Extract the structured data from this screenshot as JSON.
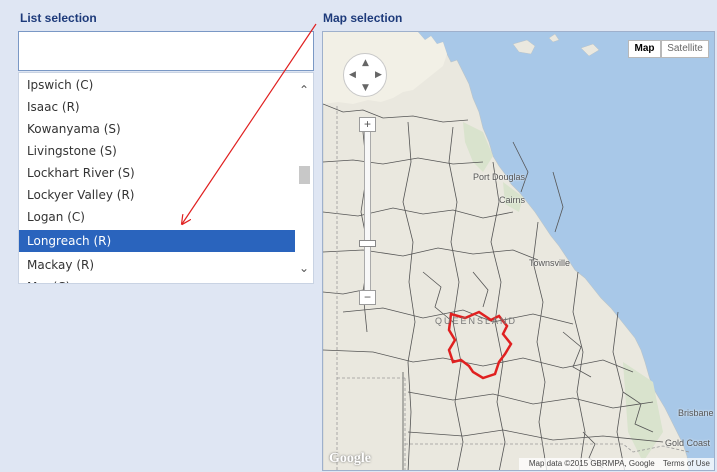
{
  "labels": {
    "list_selection": "List selection",
    "map_selection": "Map selection"
  },
  "search": {
    "value": "",
    "placeholder": ""
  },
  "list": {
    "items": [
      {
        "label": "Ipswich (C)"
      },
      {
        "label": "Isaac (R)"
      },
      {
        "label": "Kowanyama (S)"
      },
      {
        "label": "Livingstone (S)"
      },
      {
        "label": "Lockhart River (S)"
      },
      {
        "label": "Lockyer Valley (R)"
      },
      {
        "label": "Logan (C)"
      },
      {
        "label": "Longreach (R)"
      },
      {
        "label": "Mackay (R)"
      },
      {
        "label": "M... (C)"
      }
    ],
    "selected_index": 7
  },
  "map": {
    "type_buttons": {
      "map": "Map",
      "satellite": "Satellite"
    },
    "zoom": {
      "plus": "+",
      "minus": "−"
    },
    "places": {
      "port_douglas": "Port Douglas",
      "cairns": "Cairns",
      "townsville": "Townsville",
      "brisbane": "Brisbane",
      "gold_coast": "Gold Coast",
      "queensland": "QUEENSLAND"
    },
    "logo": "Google",
    "attribution": "Map data ©2015 GBRMPA, Google",
    "terms": "Terms of Use"
  },
  "colors": {
    "selected": "#2a64bd",
    "highlight_region": "#e02020",
    "arrow": "#e02020",
    "label": "#1d3a7a"
  }
}
